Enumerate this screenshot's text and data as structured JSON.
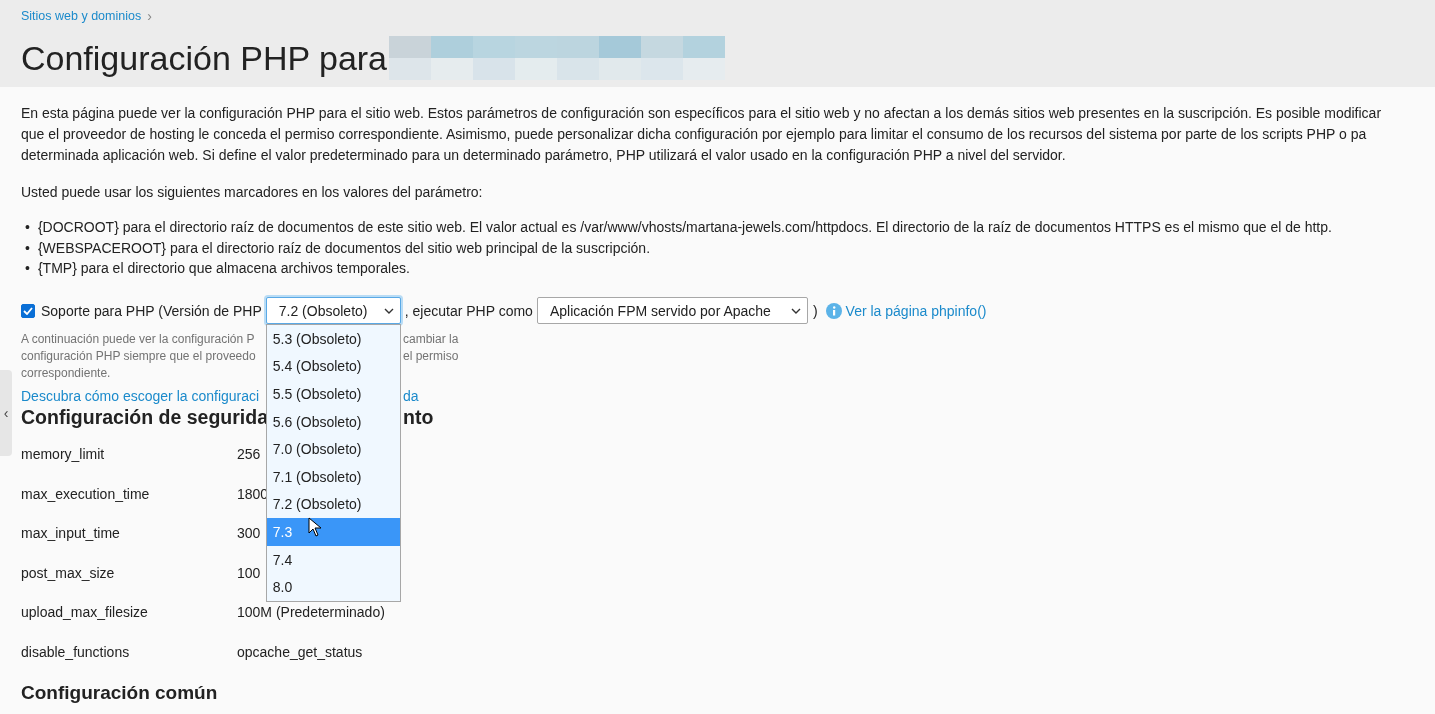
{
  "breadcrumb": "Sitios web y dominios",
  "breadcrumb_separator": "›",
  "title": "Configuración PHP para",
  "intro_lines": [
    "En esta página puede ver la configuración PHP para el sitio web. Estos parámetros de configuración son específicos para el sitio web y no afectan a los demás sitios web presentes en la suscripción. Es posible modificar",
    "que el proveedor de hosting le conceda el permiso correspondiente. Asimismo, puede personalizar dicha configuración por ejemplo para limitar el consumo de los recursos del sistema por parte de los scripts PHP o pa",
    "determinada aplicación web. Si define el valor predeterminado para un determinado parámetro, PHP utilizará el valor usado en la configuración PHP a nivel del servidor."
  ],
  "placeholders_intro": "Usted puede usar los siguientes marcadores en los valores del parámetro:",
  "bullet": "•",
  "placeholders": [
    "{DOCROOT} para el directorio raíz de documentos de este sitio web. El valor actual es /var/www/vhosts/martana-jewels.com/httpdocs. El directorio de la raíz de documentos HTTPS es el mismo que el de http.",
    "{WEBSPACEROOT} para el directorio raíz de documentos del sitio web principal de la suscripción.",
    "{TMP} para el directorio que almacena archivos temporales."
  ],
  "php_support": {
    "checked": true,
    "label": "Soporte para PHP (Versión de PHP",
    "version": "7.2 (Obsoleto)",
    "run_as_label": ", ejecutar PHP como",
    "handler": "Aplicación FPM servido por Apache",
    "close_paren": ")",
    "phpinfo_link": "Ver la página phpinfo()"
  },
  "version_options": [
    {
      "label": "5.3 (Obsoleto)",
      "selected": false
    },
    {
      "label": "5.4 (Obsoleto)",
      "selected": false
    },
    {
      "label": "5.5 (Obsoleto)",
      "selected": false
    },
    {
      "label": "5.6 (Obsoleto)",
      "selected": false
    },
    {
      "label": "7.0 (Obsoleto)",
      "selected": false
    },
    {
      "label": "7.1 (Obsoleto)",
      "selected": false
    },
    {
      "label": "7.2 (Obsoleto)",
      "selected": false
    },
    {
      "label": "7.3",
      "selected": true
    },
    {
      "label": "7.4",
      "selected": false
    },
    {
      "label": "8.0",
      "selected": false
    }
  ],
  "hint_lines": [
    {
      "left": "A continuación puede ver la configuración P",
      "right": "cambiar la"
    },
    {
      "left": "configuración PHP siempre que el proveedo",
      "right": "el permiso"
    },
    {
      "left": "correspondiente."
    }
  ],
  "guide_link": {
    "left": "Descubra cómo escoger la configuraci",
    "right": "da"
  },
  "security_heading": {
    "left": "Configuración de segurida",
    "right": "nto"
  },
  "settings": [
    {
      "name": "memory_limit",
      "value": "256"
    },
    {
      "name": "max_execution_time",
      "value": "1800"
    },
    {
      "name": "max_input_time",
      "value": "300"
    },
    {
      "name": "post_max_size",
      "value": "100"
    },
    {
      "name": "upload_max_filesize",
      "value": "100M (Predeterminado)"
    },
    {
      "name": "disable_functions",
      "value": "opcache_get_status"
    }
  ],
  "common_heading": "Configuración común",
  "sidebar_toggle": "‹"
}
